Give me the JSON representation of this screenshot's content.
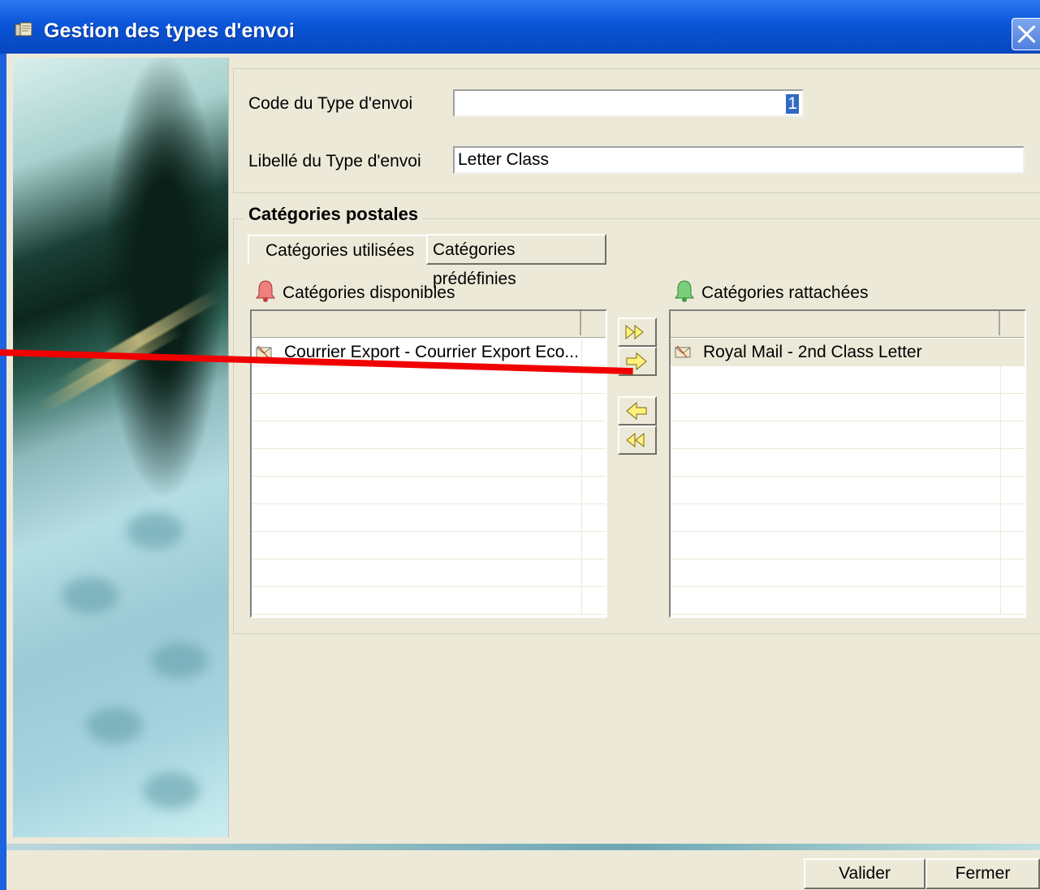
{
  "window": {
    "title": "Gestion des types d'envoi"
  },
  "form": {
    "code_label": "Code du Type d'envoi",
    "code_value": "1",
    "libelle_label": "Libellé du Type d'envoi",
    "libelle_value": "Letter Class"
  },
  "categories": {
    "group_title": "Catégories postales",
    "tabs": [
      {
        "label": "Catégories utilisées"
      },
      {
        "label": "Catégories prédéfinies"
      }
    ],
    "available_label": "Catégories disponibles",
    "attached_label": "Catégories rattachées",
    "available_items": [
      {
        "label": "Courrier Export - Courrier Export Eco..."
      }
    ],
    "attached_items": [
      {
        "label": "Royal Mail - 2nd Class Letter"
      }
    ]
  },
  "buttons": {
    "validate": "Valider",
    "close": "Fermer"
  },
  "colors": {
    "titlebar": "#0a55d8",
    "dialog": "#ece9d8",
    "annotation": "#f00000"
  }
}
